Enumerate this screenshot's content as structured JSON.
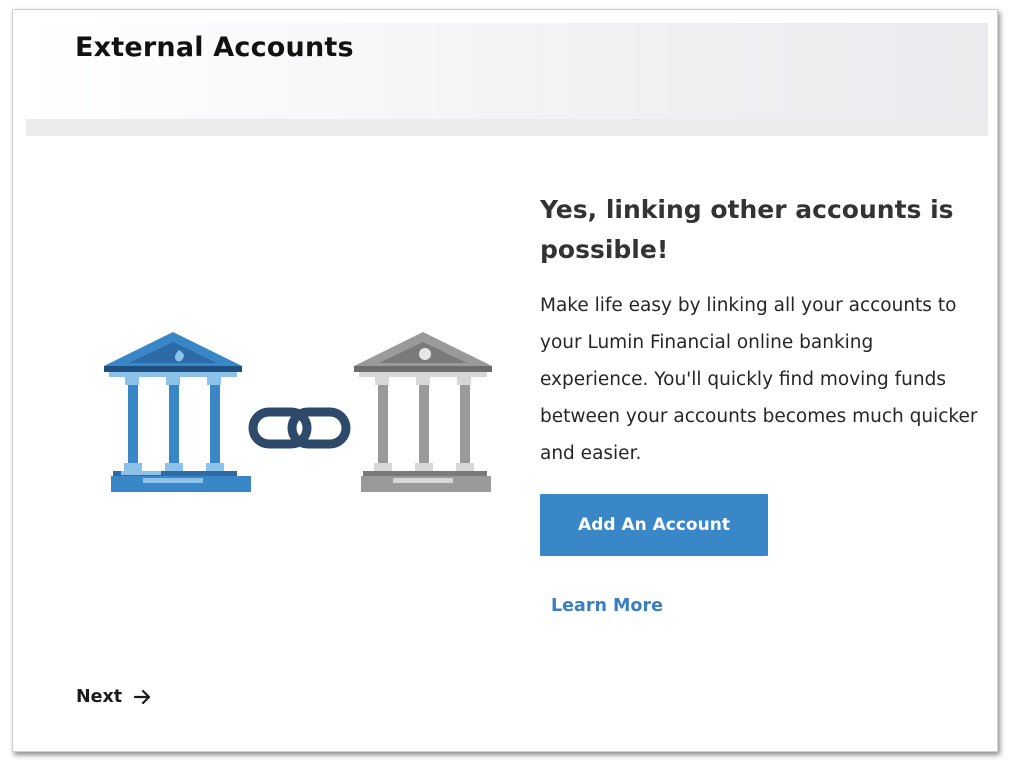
{
  "header": {
    "title": "External Accounts"
  },
  "illustration": {
    "left_bank_icon": "bank-icon",
    "link_icon": "chain-link-icon",
    "right_bank_icon": "bank-icon",
    "colors": {
      "blue_bank": "#3a87c8",
      "blue_dark": "#2c6aa8",
      "blue_light": "#8cc2ea",
      "chain": "#2e4a6b",
      "gray_bank": "#9a9a9a",
      "gray_dark": "#7a7a7a",
      "gray_light": "#d7d7d7"
    }
  },
  "main": {
    "headline": "Yes, linking other accounts is possible!",
    "description": "Make life easy by linking all your accounts to your Lumin Financial online banking experience. You'll quickly find moving funds between your accounts becomes much quicker and easier.",
    "add_account_label": "Add An Account",
    "learn_more_label": "Learn More"
  },
  "footer": {
    "next_label": "Next",
    "next_icon": "arrow-right-icon"
  },
  "colors": {
    "accent": "#3a87c8",
    "link": "#3a7fc1",
    "header_bg": "#eef0f2"
  }
}
